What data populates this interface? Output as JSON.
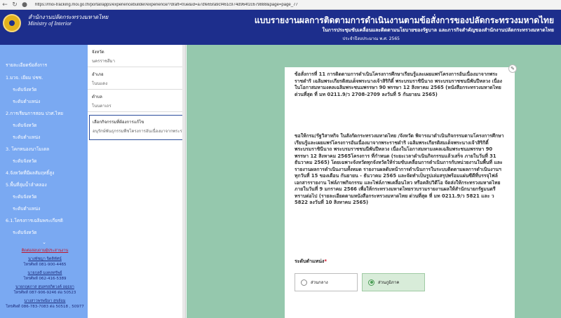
{
  "browser": {
    "url": "https://moi-tracking.moi.go.th/portal/apps/experiencebuilder/experience/?draft=true&id=a7dfe65fa9cf461c974d964f2c679888&page=page_77"
  },
  "header": {
    "org_th": "สำนักงานปลัดกระทรวงมหาดไทย",
    "org_en": "Ministry of Interior",
    "title": "แบบรายงานผลการติดตามการดำเนินงานตามข้อสั่งการของปลัดกระทรวงมหาดไทย",
    "subtitle": "ในการประชุมขับเคลื่อนและติดตามนโยบายของรัฐบาล และภารกิจสำคัญของสำนักงานปลัดกระทรวงมหาดไทย",
    "year": "ประจำปีงบประมาณ พ.ศ. 2565"
  },
  "sidebar": {
    "heading": "รายละเอียดข้อสั่งการ",
    "items": [
      {
        "label": "1.มวจ. เยียม ปชช.",
        "sub": false
      },
      {
        "label": "ระดับจังหวัด",
        "sub": true
      },
      {
        "label": "ระดับตำแหน่ง",
        "sub": true
      },
      {
        "label": "2.การเรียนการสอน ปวศ.ไทย",
        "sub": false
      },
      {
        "label": "ระดับจังหวัด",
        "sub": true
      },
      {
        "label": "ระดับตำแหน่ง",
        "sub": true
      },
      {
        "label": "3. โคกหนองนาโมเดล",
        "sub": false
      },
      {
        "label": "ระดับจังหวัด",
        "sub": true
      },
      {
        "label": "4.จังหวัดที่มีผลสัมฤทธิ์สูง",
        "sub": false
      },
      {
        "label": "5.พื้นที่ลุ่มน้ำลำคลอง",
        "sub": false
      },
      {
        "label": "ระดับจังหวัด",
        "sub": true
      },
      {
        "label": "ระดับตำแหน่ง",
        "sub": true
      },
      {
        "label": "6.1.โครงการเฉลิมพระเกียรติ",
        "sub": false
      },
      {
        "label": "ระดับจังหวัด",
        "sub": true
      }
    ],
    "contact_link": "ติดต่อสอบถามผู้ประสานงาน",
    "contacts": [
      {
        "name": "นางพัชญา จิตติทัศน์",
        "phone": "โทรศัพท์ 081-900-4465"
      },
      {
        "name": "นายกุลดี มงคลทรัพย์",
        "phone": "โทรศัพท์ 062-416-5389"
      },
      {
        "name": "นายกฤตภาส สุนทรสภิตวงค์ อยุธยา",
        "phone": "โทรศัพท์ 087-906-9246 ต่อ 50523"
      },
      {
        "name": "นางสาวพรพนิษา สุขล้อม",
        "phone": "โทรศัพท์ 086-783-7083 ต่อ 50518 , 50977"
      }
    ]
  },
  "filters": [
    {
      "label": "จังหวัด",
      "value": "นครราชสีมา"
    },
    {
      "label": "อำเภอ",
      "value": "โนนแดง"
    },
    {
      "label": "ตำบล",
      "value": "โนนตาเถร"
    }
  ],
  "activity_filter": {
    "label": "เลือกกิจกรรมที่ต้องการแก้ไข",
    "value": "อนุรักษ์พันธุกรรมพืชโครงการอันเนื่องมาจากพระราช..."
  },
  "form": {
    "paragraph1": "ข้อสั่งการที่ 11 การติดตามการดำเนินโครงการศึกษาเรียนรู้และเผยแพร่โครงการอันเนื่องมาจากพระราชดำริ เฉลิมพระเกียรติสมเด็จพระนางเจ้าสิริกิติ์ พระบรมราชินีนาถ พระบรมราชชนนีพันปีหลวง เนื่องในโอกาสมหามงคลเฉลิมพระชนมพรรษา 90 พรรษา 12 สิงหาคม 2565 (หนังสือกระทรวงมหาดไทย ด่วนที่สุด ที่ มท 0211.9/ว 2708-2709 ลงวันที่ 5 กันยายน 2565)",
    "paragraph2": "ขอให้กรม/รัฐวิสาหกิจ ในสังกัดกระทรวงมหาดไทย /จังหวัด พิจารณาดำเนินกิจกรรมตามโครงการศึกษาเรียนรู้และเผยแพร่โครงการอันเนื่องมาจากพระราชดำริ เฉลิมพระเกียรติสมเด็จพระนางเจ้าสิริกิติ์ พระบรมราชินีนาถ พระบรมราชชนนีพันปีหลวง เนื่องในโอกาสมหามงคลเฉลิมพระชนมพรรษา 90 พรรษา 12 สิงหาคม 2565โครงการ ที่กำหนด (ระยะเวลาดำเนินกิจกรรมแล้วเสร็จ ภายในวันที่ 31 ธันวาคม 2565) โดยเฉพาะจังหวัดทุกจังหวัดให้ร่วมขับเคลื่อนการดำเนินการกับหน่วยงานในพื้นที่ และรายงานผลการดำเนินงานทั้งหมด รายงานผลดับหน้าการดำเนินการในระบบติดตามผลการดำเนินงานฯ ทุกวันที่ 15 ของเดือน กันยายน - ธันวาคม 2565 และจัดทำเป็นรูปเล่มสรุปพร้อมแผ่นซีดีที่บรรจุไฟล์เอกสารรายงาน ไฟล์ภาพกิจกรรม และไฟล์ภาพเคลื่อนไหว หรือคลิปวิดีโอ จัดส่งให้กระทรวงมหาดไทย ภายในวันที่ 9 มกราคม 2566 เพื่อให้กระทรวงมหาดไทยรวบรวมรายงานผลให้สำนักนายกรัฐมนตรีทราบต่อไป (รายละเอียดตามหนังสือกระทรวงมหาดไทย ด่วนที่สุด ที่ มท 0211.9/ว 5821 และ ว 5822 ลงวันที่ 10 สิงหาคม 2565)",
    "field_label": "ระดับตำแหน่ง",
    "options": [
      "ส่วนกลาง",
      "ส่วนภูมิภาค"
    ],
    "selected": "ส่วนภูมิภาค"
  }
}
